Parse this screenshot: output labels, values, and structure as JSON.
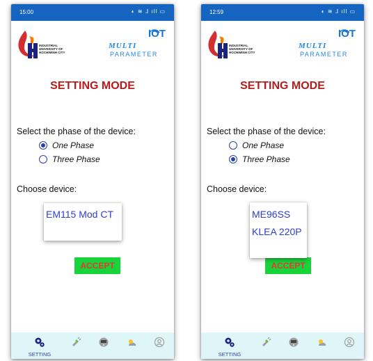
{
  "screens": [
    {
      "status_time": "15:00",
      "university_logo_text": [
        "INDUSTRIAL",
        "UNIVERSITY OF",
        "HOCHIMINH CITY"
      ],
      "iot_logo": {
        "iot": "IOT",
        "multi": "MULTI",
        "parameter": "PARAMETER"
      },
      "title": "SETTING MODE",
      "phase_prompt": "Select the phase of the device:",
      "phase_options": [
        {
          "label": "One Phase",
          "selected": true
        },
        {
          "label": "Three Phase",
          "selected": false
        }
      ],
      "device_prompt": "Choose device:",
      "device_options": [
        "EM115 Mod CT"
      ],
      "accept_label": "ACCEPT",
      "nav": {
        "active_label": "SETTING"
      }
    },
    {
      "status_time": "12:59",
      "university_logo_text": [
        "INDUSTRIAL",
        "UNIVERSITY OF",
        "HOCHIMINH CITY"
      ],
      "iot_logo": {
        "iot": "IOT",
        "multi": "MULTI",
        "parameter": "PARAMETER"
      },
      "title": "SETTING MODE",
      "phase_prompt": "Select the phase of the device:",
      "phase_options": [
        {
          "label": "One Phase",
          "selected": false
        },
        {
          "label": "Three Phase",
          "selected": true
        }
      ],
      "device_prompt": "Choose device:",
      "device_options": [
        "ME96SS",
        "KLEA 220P"
      ],
      "accept_label": "ACCEPT",
      "nav": {
        "active_label": "SETTING"
      }
    }
  ],
  "status_icons": "◐ ≋ ⅃ ıll ▭",
  "nav_icons": [
    "gears-icon",
    "plug-icon",
    "meter-icon",
    "weather-icon",
    "account-icon"
  ],
  "colors": {
    "statusbar": "#1565c0",
    "title": "#b71c1c",
    "radio": "#2b3fa8",
    "device_text": "#2b3fcf",
    "accept_bg": "#19d33a",
    "accept_text": "#e53935",
    "navbar_bg": "#dff6f9"
  }
}
